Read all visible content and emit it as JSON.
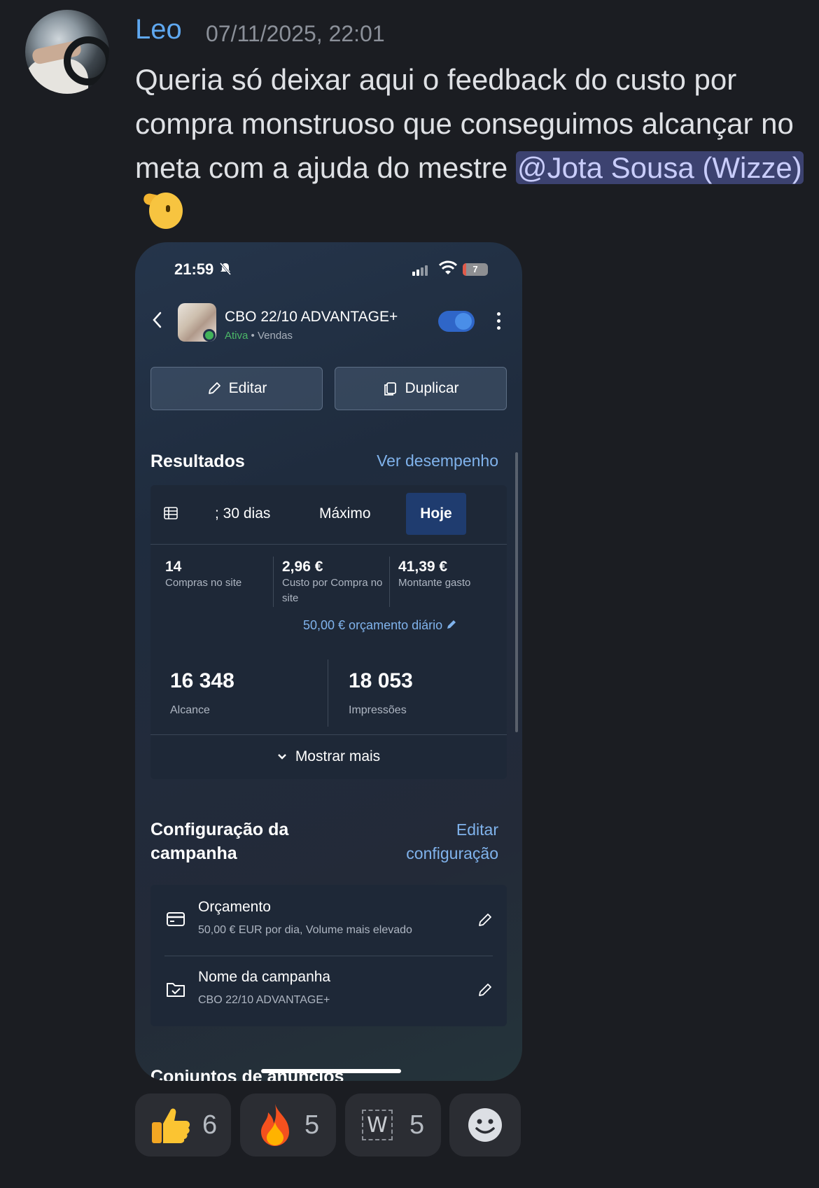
{
  "message": {
    "author": "Leo",
    "timestamp": "07/11/2025, 22:01",
    "text": "Queria só deixar aqui o feedback do custo por compra monstruoso que conseguimos alcançar no meta com a ajuda do mestre",
    "mention": "@Jota Sousa (Wizze)",
    "emoji": "saluting-face"
  },
  "phone": {
    "status_bar": {
      "time": "21:59",
      "battery": "7"
    },
    "header": {
      "campaign_name": "CBO 22/10 ADVANTAGE+",
      "status": "Ativa",
      "separator": "•",
      "objective": "Vendas"
    },
    "buttons": {
      "edit": "Editar",
      "duplicate": "Duplicar"
    },
    "results": {
      "title": "Resultados",
      "link": "Ver desempenho",
      "tabs": [
        ":s 30 dias",
        "Máximo",
        "Hoje"
      ],
      "tab_30_dias": "; 30 dias",
      "tab_maximo": "Máximo",
      "tab_hoje": "Hoje",
      "metrics": [
        {
          "value": "14",
          "label": "Compras no site"
        },
        {
          "value": "2,96 €",
          "label": "Custo por Compra no site"
        },
        {
          "value": "41,39 €",
          "label": "Montante gasto"
        }
      ],
      "budget_note": "50,00 € orçamento diário",
      "reach": {
        "value": "16 348",
        "label": "Alcance"
      },
      "impressions": {
        "value": "18 053",
        "label": "Impressões"
      },
      "show_more": "Mostrar mais"
    },
    "config": {
      "title": "Configuração da campanha",
      "link": "Editar configuração",
      "items": [
        {
          "title": "Orçamento",
          "subtitle": "50,00 € EUR por dia, Volume mais elevado"
        },
        {
          "title": "Nome da campanha",
          "subtitle": "CBO 22/10 ADVANTAGE+"
        }
      ]
    },
    "next_section": "Conjuntos de anúncios"
  },
  "reactions": [
    {
      "emoji": "thumbs-up",
      "count": "6"
    },
    {
      "emoji": "fire",
      "count": "5"
    },
    {
      "emoji": "W",
      "count": "5"
    },
    {
      "emoji": "add-reaction"
    }
  ],
  "colors": {
    "username": "#5fa8f0",
    "mention_bg": "#3c4270",
    "link": "#80b3ec",
    "active": "#4cb868",
    "toggle": "#2f66c8"
  }
}
